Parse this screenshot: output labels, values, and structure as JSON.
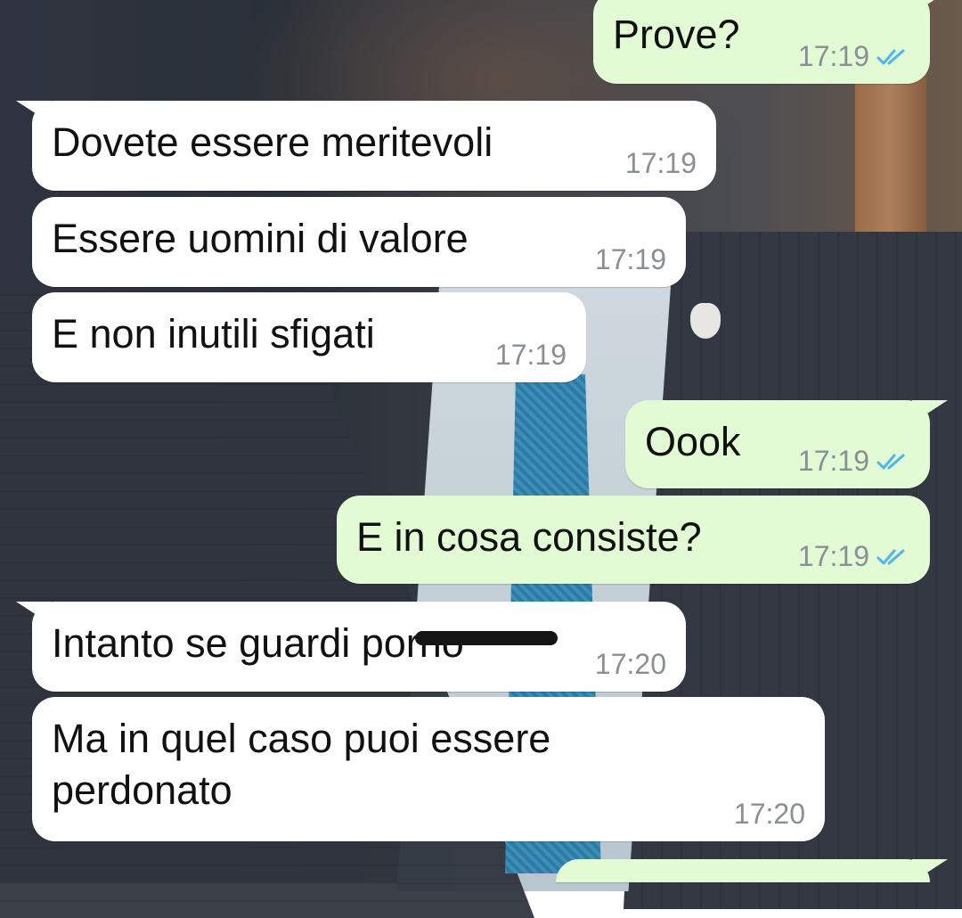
{
  "chat": {
    "messages": [
      {
        "direction": "out",
        "text": "Prove?",
        "time": "17:19",
        "status": "read"
      },
      {
        "direction": "in",
        "text": "Dovete essere meritevoli",
        "time": "17:19"
      },
      {
        "direction": "in",
        "text": "Essere uomini di valore",
        "time": "17:19"
      },
      {
        "direction": "in",
        "text": "E non inutili sfigati",
        "time": "17:19"
      },
      {
        "direction": "out",
        "text": "Oook",
        "time": "17:19",
        "status": "read"
      },
      {
        "direction": "out",
        "text": "E in cosa consiste?",
        "time": "17:19",
        "status": "read"
      },
      {
        "direction": "in",
        "text": "Intanto se guardi porno",
        "time": "17:20",
        "redacted_word": "porno"
      },
      {
        "direction": "in",
        "text": "Ma in quel caso puoi essere\nperdonato",
        "time": "17:20"
      },
      {
        "direction": "out",
        "text": "",
        "time": "",
        "partial": true
      }
    ]
  },
  "colors": {
    "incoming_bubble": "#ffffff",
    "outgoing_bubble": "#e2fbd5",
    "timestamp": "#8a8f93",
    "read_ticks": "#4fb6ec"
  },
  "icons": {
    "read_status": "double-check-icon"
  }
}
